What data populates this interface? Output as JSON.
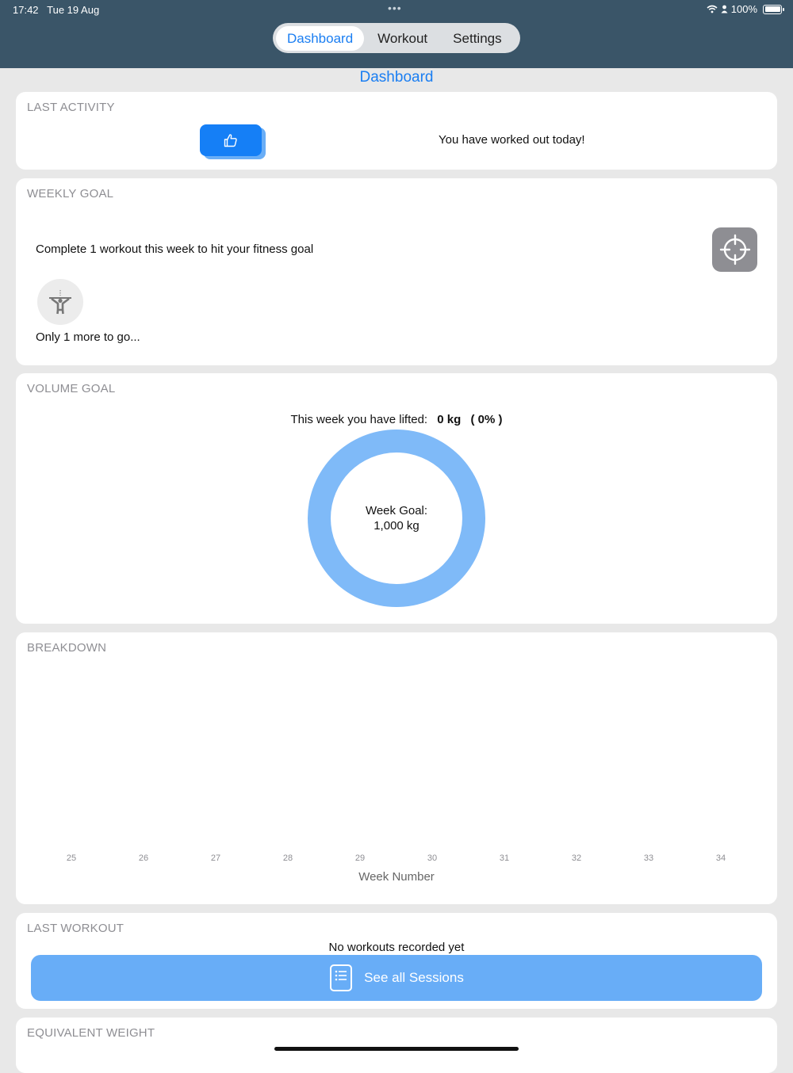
{
  "status_bar": {
    "time": "17:42",
    "date": "Tue 19 Aug",
    "dots": "•••",
    "battery": "100%"
  },
  "tabs": [
    {
      "label": "Dashboard",
      "active": true
    },
    {
      "label": "Workout",
      "active": false
    },
    {
      "label": "Settings",
      "active": false
    }
  ],
  "page_title": "Dashboard",
  "last_activity": {
    "title": "LAST ACTIVITY",
    "button_icon": "thumbs-up-icon",
    "message": "You have worked out today!"
  },
  "weekly_goal": {
    "title": "WEEKLY GOAL",
    "goal_text": "Complete 1 workout this week to hit your fitness goal",
    "target_icon": "crosshair-icon",
    "person_icon": "person-icon",
    "remaining_text": "Only 1 more to go..."
  },
  "volume_goal": {
    "title": "VOLUME GOAL",
    "lifted_label": "This week you have lifted:",
    "lifted_value": "0 kg",
    "lifted_percent": "( 0% )",
    "progress_fraction": 0,
    "ring_color": "#7fbaf8",
    "goal_line1": "Week Goal:",
    "goal_line2": "1,000 kg"
  },
  "breakdown": {
    "title": "BREAKDOWN",
    "week_ticks": [
      "25",
      "26",
      "27",
      "28",
      "29",
      "30",
      "31",
      "32",
      "33",
      "34"
    ],
    "x_axis_label": "Week Number"
  },
  "chart_data": {
    "type": "bar",
    "categories": [
      "25",
      "26",
      "27",
      "28",
      "29",
      "30",
      "31",
      "32",
      "33",
      "34"
    ],
    "values": [
      0,
      0,
      0,
      0,
      0,
      0,
      0,
      0,
      0,
      0
    ],
    "xlabel": "Week Number",
    "ylabel": ""
  },
  "last_workout": {
    "title": "LAST WORKOUT",
    "empty_text": "No workouts recorded yet",
    "sessions_button": "See all Sessions",
    "sessions_icon": "list-document-icon"
  },
  "equivalent_weight": {
    "title": "EQUIVALENT WEIGHT"
  },
  "colors": {
    "header": "#3a5568",
    "accent": "#1a7ef2",
    "button_light": "#68adf7"
  }
}
